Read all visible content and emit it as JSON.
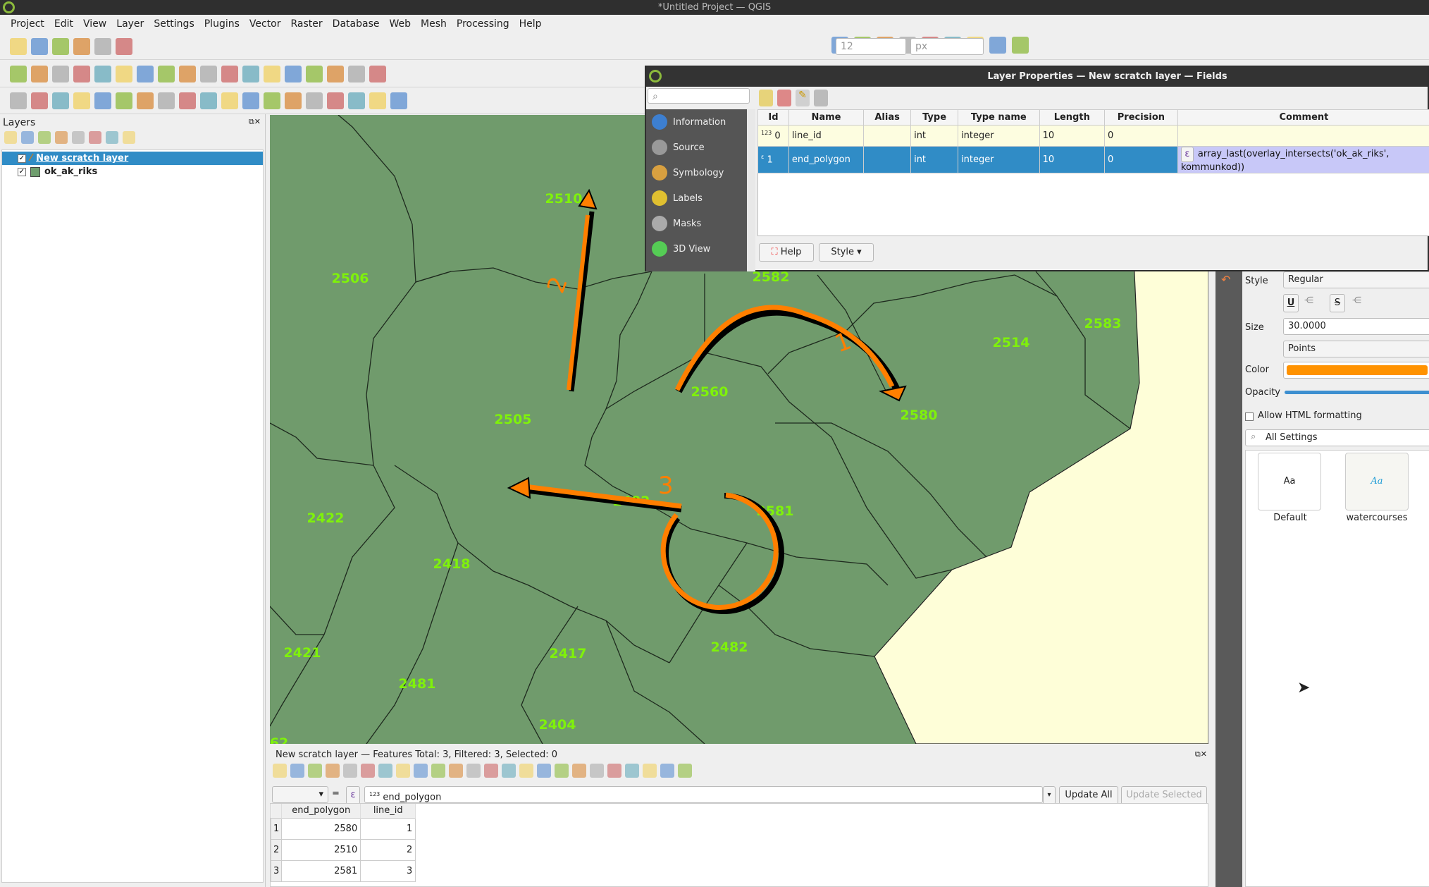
{
  "window": {
    "title": "*Untitled Project — QGIS"
  },
  "menu": [
    "Project",
    "Edit",
    "View",
    "Layer",
    "Settings",
    "Plugins",
    "Vector",
    "Raster",
    "Database",
    "Web",
    "Mesh",
    "Processing",
    "Help"
  ],
  "toolbars": {
    "row1": [
      "new-project-icon",
      "open-project-icon",
      "save-project-icon",
      "save-as-icon",
      "print-layout-icon",
      "style-manager-icon"
    ],
    "row1_right": [
      "identify-icon",
      "attribute-table-icon",
      "processing-toolbox-icon",
      "statistics-icon",
      "open-field-calculator-icon",
      "measure-icon",
      "map-tips-icon",
      "locate-icon",
      "snapping-icon"
    ],
    "snapping": {
      "tolerance": "12",
      "unit": "px"
    },
    "row2": [
      "data-source-manager-icon",
      "new-geopackage-icon",
      "new-shapefile-icon",
      "new-temp-layer-icon",
      "new-virtual-layer-icon",
      "digitize-icon",
      "toggle-editing-icon",
      "save-edits-icon",
      "vertex-tool-icon",
      "cut-icon",
      "copy-icon",
      "paste-icon",
      "undo-icon",
      "redo-icon",
      "label-icon",
      "diagram-icon",
      "pin-labels-icon",
      "show-hide-labels-icon"
    ],
    "row3": [
      "select-features-icon",
      "select-by-expression-icon",
      "deselect-icon",
      "select-by-location-icon",
      "add-postgis-icon",
      "pan-icon",
      "pan-to-selection-icon",
      "zoom-in-icon",
      "zoom-out-icon",
      "zoom-full-icon",
      "zoom-to-selection-icon",
      "zoom-to-layer-icon",
      "zoom-native-icon",
      "zoom-last-icon",
      "zoom-next-icon",
      "new-bookmark-icon",
      "show-bookmarks-icon",
      "temporal-controller-icon",
      "refresh-icon"
    ]
  },
  "layers_panel": {
    "title": "Layers",
    "items": [
      {
        "name": "New scratch layer",
        "checked": true,
        "selected": true
      },
      {
        "name": "ok_ak_riks",
        "checked": true,
        "selected": false,
        "color": "#6f9e6e"
      }
    ]
  },
  "map": {
    "fill": "#709b6c",
    "sea": "#fefed8",
    "label_color": "#7ff20a",
    "arrow_color": "#ff7f00",
    "labels": [
      "2510",
      "2506",
      "2582",
      "2583",
      "2514",
      "2560",
      "2580",
      "2505",
      "2482",
      "2581",
      "2422",
      "2418",
      "2421",
      "2417",
      "2482",
      "2481",
      "2404",
      "62"
    ],
    "line_labels": [
      "1",
      "2",
      "3"
    ]
  },
  "dialog": {
    "title": "Layer Properties — New scratch layer — Fields",
    "search_placeholder": "",
    "sidebar": [
      "Information",
      "Source",
      "Symbology",
      "Labels",
      "Masks",
      "3D View"
    ],
    "columns": [
      "Id",
      "Name",
      "Alias",
      "Type",
      "Type name",
      "Length",
      "Precision",
      "Comment"
    ],
    "rows": [
      {
        "icon": "123",
        "id": "0",
        "name": "line_id",
        "alias": "",
        "type": "int",
        "type_name": "integer",
        "length": "10",
        "precision": "0",
        "comment": ""
      },
      {
        "icon": "ε",
        "id": "1",
        "name": "end_polygon",
        "alias": "",
        "type": "int",
        "type_name": "integer",
        "length": "10",
        "precision": "0",
        "comment": "array_last(overlay_intersects('ok_ak_riks', kommunkod))"
      }
    ],
    "help": "Help",
    "style": "Style"
  },
  "label_panel": {
    "style_label": "Style",
    "style_value": "Regular",
    "size_label": "Size",
    "size_value": "30.0000",
    "unit_value": "Points",
    "color_label": "Color",
    "color": "#ff9200",
    "opacity_label": "Opacity",
    "opacity": 1.0,
    "html_label": "Allow HTML formatting",
    "html_checked": false,
    "settings_search": "All Settings",
    "presets": [
      {
        "preview": "Aa",
        "name": "Default"
      },
      {
        "preview": "Aa",
        "name": "watercourses"
      }
    ]
  },
  "attribute_table": {
    "title": "New scratch layer — Features Total: 3, Filtered: 3, Selected: 0",
    "field_combo": "",
    "equals": "=",
    "expression": "end_polygon",
    "expression_badge": "123",
    "update_all": "Update All",
    "update_selected": "Update Selected",
    "columns": [
      "end_polygon",
      "line_id"
    ],
    "rows": [
      [
        "1",
        "2580",
        "1"
      ],
      [
        "2",
        "2510",
        "2"
      ],
      [
        "3",
        "2581",
        "3"
      ]
    ]
  }
}
